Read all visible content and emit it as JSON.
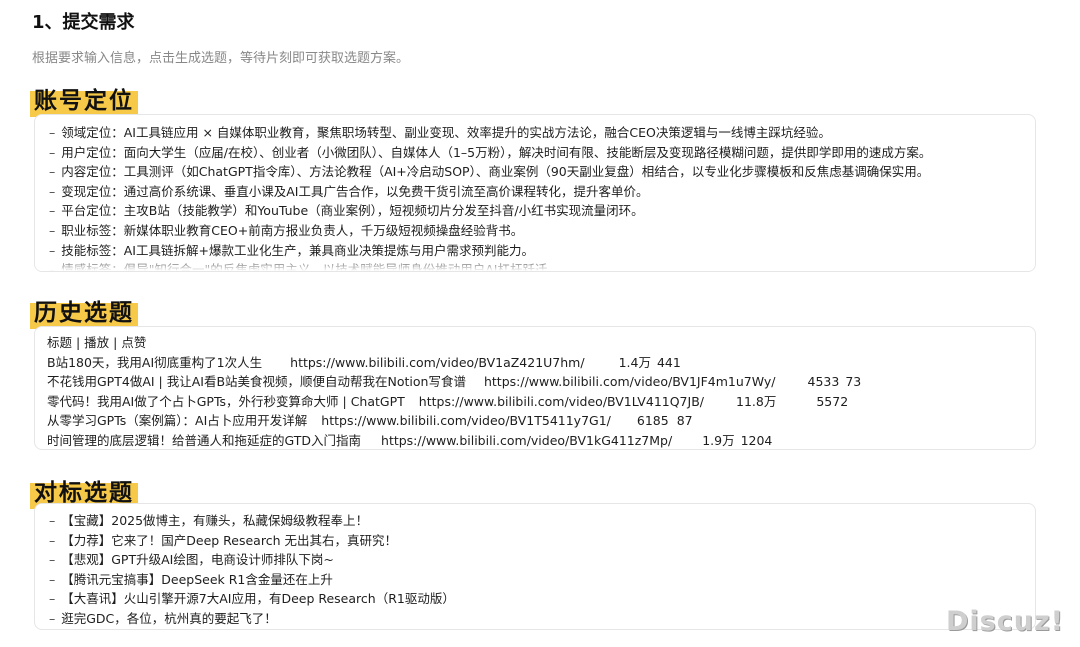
{
  "header": {
    "title": "1、提交需求",
    "subtitle": "根据要求输入信息，点击生成选题，等待片刻即可获取选题方案。"
  },
  "account_positioning": {
    "heading": "账号定位",
    "dash": "–",
    "items": [
      "领域定位：AI工具链应用 × 自媒体职业教育，聚焦职场转型、副业变现、效率提升的实战方法论，融合CEO决策逻辑与一线博主踩坑经验。",
      "用户定位：面向大学生（应届/在校）、创业者（小微团队）、自媒体人（1–5万粉），解决时间有限、技能断层及变现路径模糊问题，提供即学即用的速成方案。",
      "内容定位：工具测评（如ChatGPT指令库）、方法论教程（AI+冷启动SOP）、商业案例（90天副业复盘）相结合，以专业化步骤模板和反焦虑基调确保实用。",
      "变现定位：通过高价系统课、垂直小课及AI工具广告合作，以免费干货引流至高价课程转化，提升客单价。",
      "平台定位：主攻B站（技能教学）和YouTube（商业案例），短视频切片分发至抖音/小红书实现流量闭环。",
      "职业标签：新媒体职业教育CEO+前南方报业负责人，千万级短视频操盘经验背书。",
      "技能标签：AI工具链拆解+爆款工业化生产，兼具商业决策提炼与用户需求预判能力。",
      "情感标签：倡导\"知行合一\"的反焦虑实用主义，以技术赋能导师身份推动用户AI杠杆跃迁。"
    ]
  },
  "history_topics": {
    "heading": "历史选题",
    "columns": "标题 | 播放 | 点赞",
    "rows": [
      {
        "title": "B站180天，我用AI彻底重构了1次人生",
        "url": "https://www.bilibili.com/video/BV1aZ421U7hm/",
        "plays": "1.4万",
        "likes": "441"
      },
      {
        "title": "不花钱用GPT4做AI | 我让AI看B站美食视频，顺便自动帮我在Notion写食谱",
        "url": "https://www.bilibili.com/video/BV1JF4m1u7Wy/",
        "plays": "4533",
        "likes": "73"
      },
      {
        "title": "零代码！我用AI做了个占卜GPTs，外行秒变算命大师 | ChatGPT",
        "url": "https://www.bilibili.com/video/BV1LV411Q7JB/",
        "plays": "11.8万",
        "likes": "5572"
      },
      {
        "title": "从零学习GPTs（案例篇）：AI占卜应用开发详解",
        "url": "https://www.bilibili.com/video/BV1T5411y7G1/",
        "plays": "6185",
        "likes": "87"
      },
      {
        "title": "时间管理的底层逻辑！给普通人和拖延症的GTD入门指南",
        "url": "https://www.bilibili.com/video/BV1kG411z7Mp/",
        "plays": "1.9万",
        "likes": "1204"
      }
    ]
  },
  "benchmark_topics": {
    "heading": "对标选题",
    "dash": "–",
    "items": [
      "【宝藏】2025做博主，有赚头，私藏保姆级教程奉上！",
      "【力荐】它来了！国产Deep Research 无出其右，真研究！",
      "【悲观】GPT升级AI绘图，电商设计师排队下岗~",
      "【腾讯元宝搞事】DeepSeek R1含金量还在上升",
      "【大喜讯】火山引擎开源7大AI应用，有Deep Research（R1驱动版）",
      "逛完GDC，各位，杭州真的要起飞了！"
    ]
  },
  "watermark": "Discuz!"
}
